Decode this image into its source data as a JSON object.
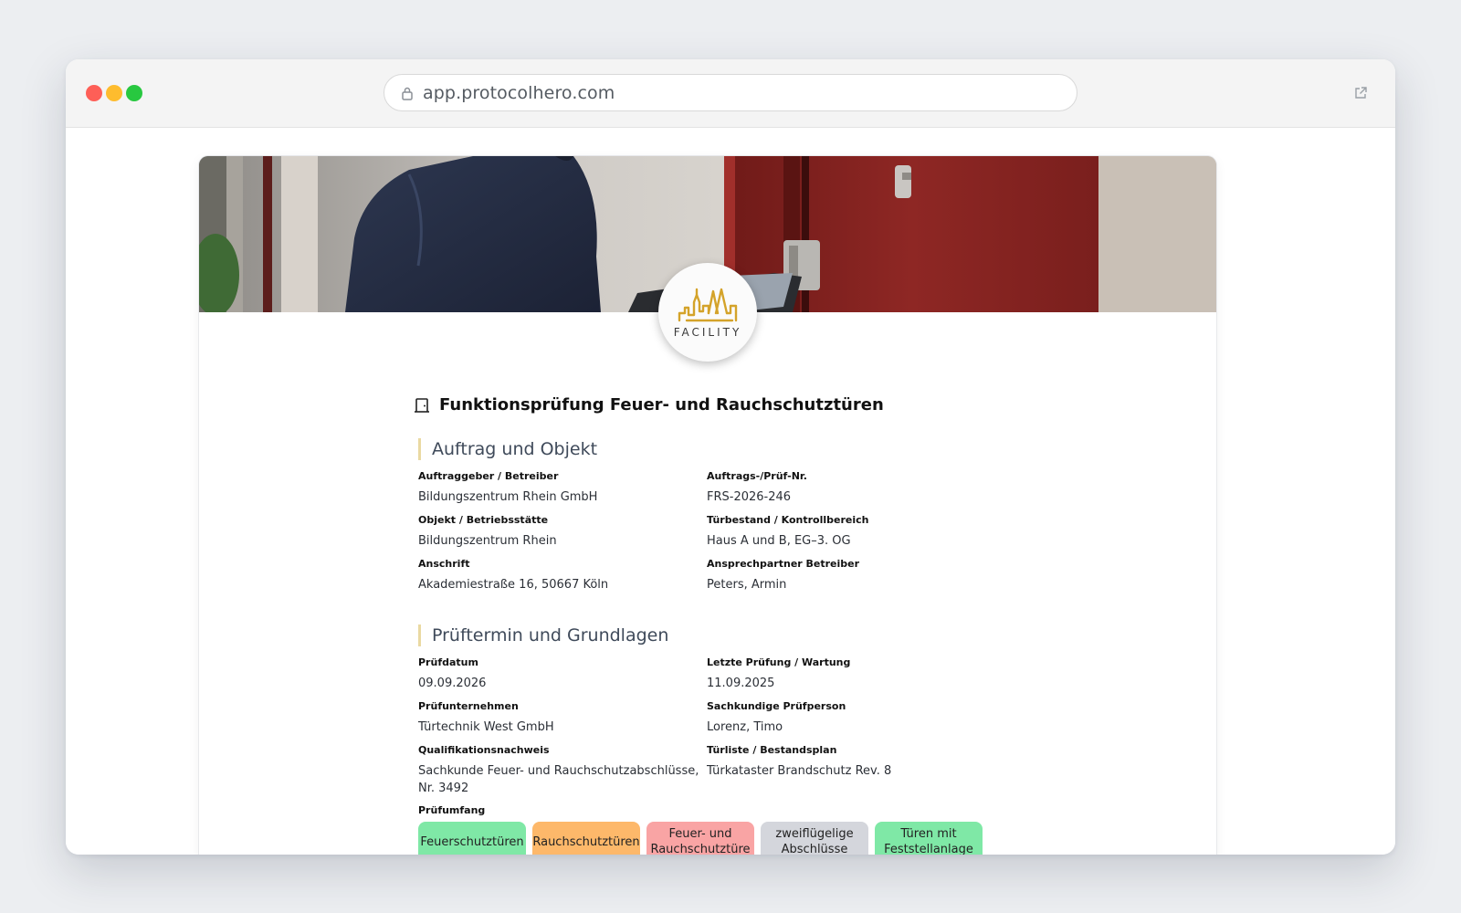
{
  "browser": {
    "url": "app.protocolhero.com"
  },
  "logo": {
    "text": "FACILITY",
    "color": "#d4a32a"
  },
  "document": {
    "title": "Funktionsprüfung Feuer- und Rauchschutztüren",
    "icon": "door-icon"
  },
  "sections": {
    "order": {
      "heading": "Auftrag und Objekt",
      "fields": [
        {
          "label": "Auftraggeber / Betreiber",
          "value": "Bildungszentrum Rhein GmbH"
        },
        {
          "label": "Auftrags-/Prüf-Nr.",
          "value": "FRS-2026-246"
        },
        {
          "label": "Objekt / Betriebsstätte",
          "value": "Bildungszentrum Rhein"
        },
        {
          "label": "Türbestand / Kontrollbereich",
          "value": "Haus A und B, EG–3. OG"
        },
        {
          "label": "Anschrift",
          "value": "Akademiestraße 16, 50667 Köln"
        },
        {
          "label": "Ansprechpartner Betreiber",
          "value": "Peters, Armin"
        }
      ]
    },
    "inspection": {
      "heading": "Prüftermin und Grundlagen",
      "fields": [
        {
          "label": "Prüfdatum",
          "value": "09.09.2026"
        },
        {
          "label": "Letzte Prüfung / Wartung",
          "value": "11.09.2025"
        },
        {
          "label": "Prüfunternehmen",
          "value": "Türtechnik West GmbH"
        },
        {
          "label": "Sachkundige Prüfperson",
          "value": "Lorenz, Timo"
        },
        {
          "label": "Qualifikationsnachweis",
          "value": "Sachkunde Feuer- und Rauchschutzabschlüsse, Nr. 3492"
        },
        {
          "label": "Türliste / Bestandsplan",
          "value": "Türkataster Brandschutz Rev. 8"
        }
      ],
      "scope_label": "Prüfumfang",
      "scope": [
        {
          "label": "Feuerschutztüren",
          "color": "#7fe8a6"
        },
        {
          "label": "Rauchschutztüren",
          "color": "#fdb86a"
        },
        {
          "label": "Feuer- und Rauchschutztüre",
          "color": "#f9a4a4"
        },
        {
          "label": "zweiflügelige Abschlüsse",
          "color": "#d4d6dc"
        },
        {
          "label": "Türen mit Feststellanlage",
          "color": "#7fe8a6"
        }
      ]
    }
  }
}
